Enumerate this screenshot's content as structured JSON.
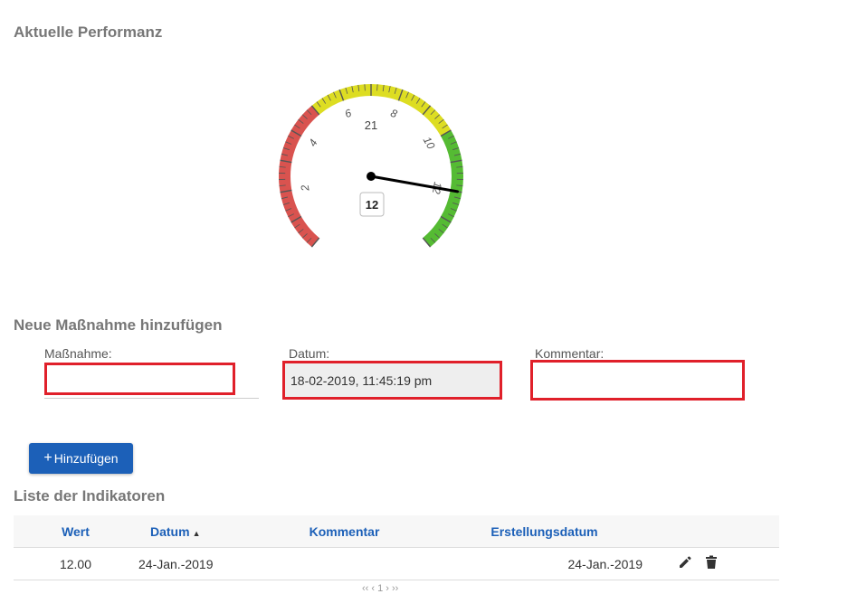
{
  "performance": {
    "title": "Aktuelle Performanz",
    "gauge": {
      "min": 0,
      "max": 14,
      "ticks": [
        "2",
        "4",
        "6",
        "8",
        "10",
        "12"
      ],
      "center_label": "21",
      "value": 12,
      "value_label": "12",
      "zones": [
        {
          "from": 0,
          "to": 5,
          "color": "#d9534f"
        },
        {
          "from": 5,
          "to": 10,
          "color": "#dddd22"
        },
        {
          "from": 10,
          "to": 14,
          "color": "#55bb33"
        }
      ]
    }
  },
  "add_form": {
    "title": "Neue Maßnahme hinzufügen",
    "measure_label": "Maßnahme:",
    "measure_value": "",
    "date_label": "Datum:",
    "date_value": "18-02-2019, 11:45:19 pm",
    "comment_label": "Kommentar:",
    "comment_value": "",
    "add_button": "Hinzufügen",
    "add_icon": "+"
  },
  "list": {
    "title": "Liste der Indikatoren",
    "columns": [
      "Wert",
      "Datum",
      "Kommentar",
      "Erstellungsdatum"
    ],
    "sort_indicator": "▲",
    "rows": [
      {
        "wert": "12.00",
        "datum": "24-Jan.-2019",
        "kommentar": "",
        "erstellungsdatum": "24-Jan.-2019"
      }
    ],
    "pager": "‹‹   ‹   1   ›   ››"
  }
}
